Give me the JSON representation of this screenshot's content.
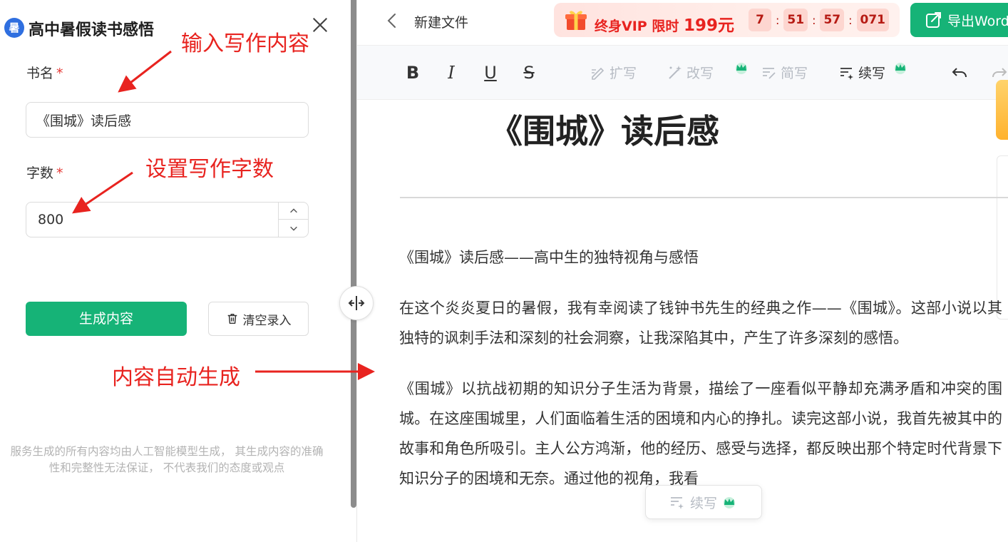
{
  "panel": {
    "title": "高中暑假读书感悟",
    "logo_glyph": "暑",
    "book_label": "书名",
    "book_value": "《围城》读后感",
    "count_label": "字数",
    "count_value": "800",
    "required_mark": "*",
    "generate_label": "生成内容",
    "clear_label": "清空录入",
    "disclaimer": "服务生成的所有内容均由人工智能模型生成， 其生成内容的准确性和完整性无法保证， 不代表我们的态度或观点"
  },
  "annotations": {
    "input": "输入写作内容",
    "count": "设置写作字数",
    "auto": "内容自动生成"
  },
  "topbar": {
    "file_name": "新建文件",
    "vip_text": "终身VIP 限时",
    "vip_price": "199元",
    "timer": [
      "7",
      "51",
      "57",
      "071"
    ],
    "timer_sep": ":",
    "export_label": "导出Word"
  },
  "toolbar": {
    "bold": "B",
    "italic": "I",
    "underline": "U",
    "strike": "S",
    "expand": "扩写",
    "rewrite": "改写",
    "simplify": "简写",
    "continue": "续写"
  },
  "document": {
    "title": "《围城》读后感",
    "paragraphs": [
      "《围城》读后感——高中生的独特视角与感悟",
      "在这个炎炎夏日的暑假，我有幸阅读了钱钟书先生的经典之作——《围城》。这部小说以其独特的讽刺手法和深刻的社会洞察，让我深陷其中，产生了许多深刻的感悟。",
      "《围城》以抗战初期的知识分子生活为背景，描绘了一座看似平静却充满矛盾和冲突的围城。在这座围城里，人们面临着生活的困境和内心的挣扎。读完这部小说，我首先被其中的故事和角色所吸引。主人公方鸿渐，他的经历、感受与选择，都反映出那个特定时代背景下知识分子的困境和无奈。通过他的视角，我看"
    ],
    "float_label": "续写"
  },
  "colors": {
    "accent": "#16b377",
    "annotation": "#e8231f",
    "vip": "#e8231f"
  }
}
